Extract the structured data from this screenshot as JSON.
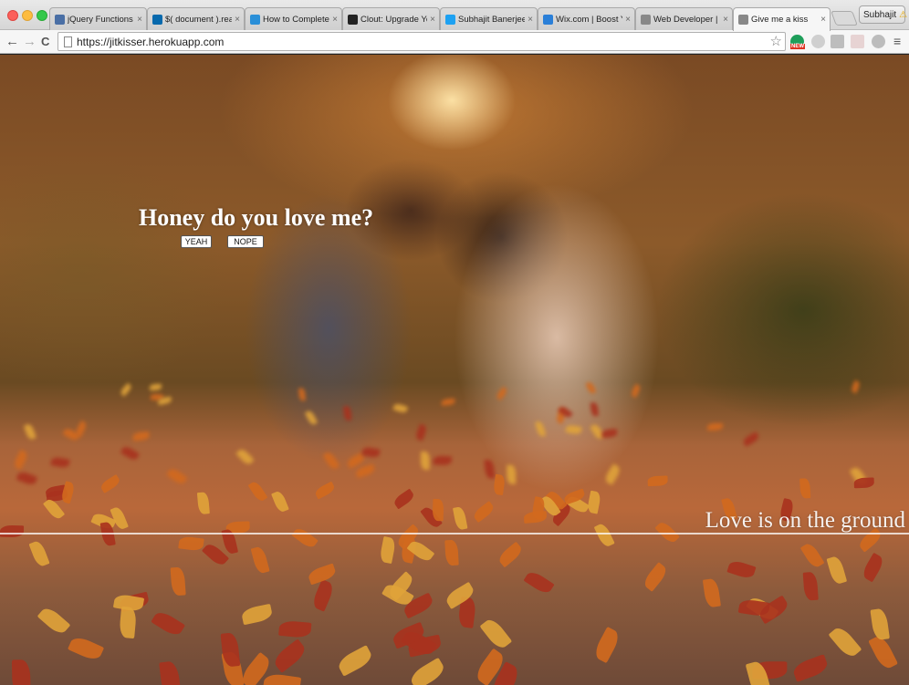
{
  "browser": {
    "tabs": [
      {
        "label": "jQuery Functions a",
        "favicon": "document-icon",
        "color": "#4a6fa5"
      },
      {
        "label": "$( document ).read",
        "favicon": "jquery-icon",
        "color": "#0769ad"
      },
      {
        "label": "How to Complete F",
        "favicon": "blue-a-icon",
        "color": "#2a8fd8"
      },
      {
        "label": "Clout: Upgrade Yo",
        "favicon": "github-icon",
        "color": "#222222"
      },
      {
        "label": "Subhajit Banerjee (",
        "favicon": "twitter-icon",
        "color": "#1da1f2"
      },
      {
        "label": "Wix.com | Boost Yo",
        "favicon": "wix-icon",
        "color": "#2a7fd8"
      },
      {
        "label": "Web Developer | Lo",
        "favicon": "document-icon",
        "color": "#888888"
      },
      {
        "label": "Give me a kiss",
        "favicon": "document-icon",
        "color": "#888888",
        "active": true
      }
    ],
    "tab_close": "×",
    "profile": {
      "name": "Subhajit",
      "warning": "⚠"
    },
    "nav": {
      "back": "←",
      "forward": "→",
      "reload": "C"
    },
    "url": "https://jitkisser.herokuapp.com",
    "bookmark_icon": "☆",
    "extension_badge": "NEW",
    "menu_icon": "≡"
  },
  "page": {
    "question": "Honey do you love me?",
    "yes_button": "YEAH",
    "no_button": "NOPE",
    "caption": "Love is on the ground"
  },
  "colors": {
    "leaf_orange": "#d2691e",
    "leaf_red": "#a8321e",
    "leaf_yellow": "#e0a33a"
  }
}
